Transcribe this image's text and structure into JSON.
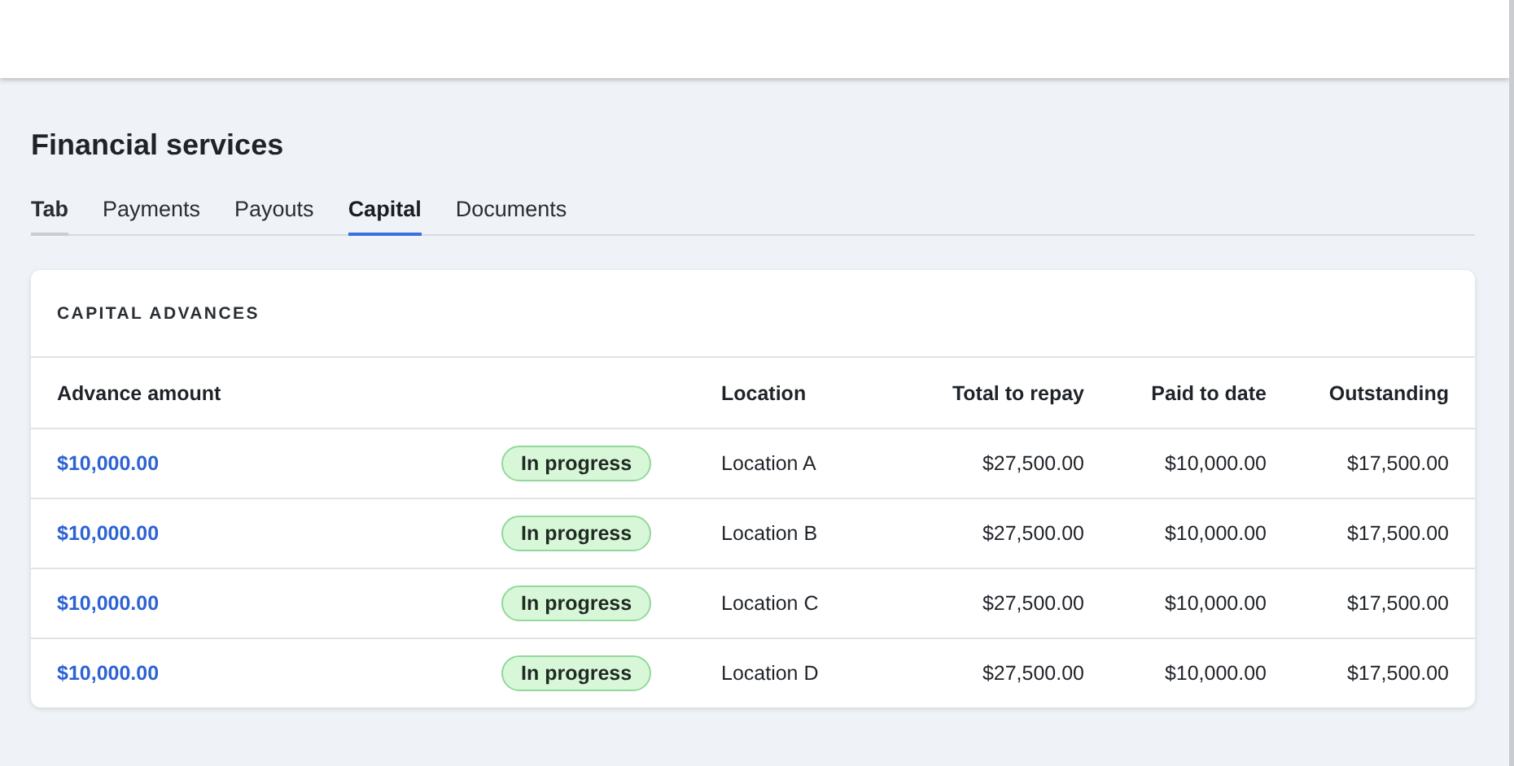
{
  "page": {
    "title": "Financial services"
  },
  "tabs": [
    {
      "label": "Tab",
      "selected": false,
      "hovered": true
    },
    {
      "label": "Payments",
      "selected": false,
      "hovered": false
    },
    {
      "label": "Payouts",
      "selected": false,
      "hovered": false
    },
    {
      "label": "Capital",
      "selected": true,
      "hovered": false
    },
    {
      "label": "Documents",
      "selected": false,
      "hovered": false
    }
  ],
  "card": {
    "title": "CAPITAL ADVANCES",
    "columns": [
      "Advance amount",
      "Location",
      "Total to repay",
      "Paid to date",
      "Outstanding"
    ],
    "rows": [
      {
        "amount": "$10,000.00",
        "status": {
          "label": "In progress",
          "kind": "success"
        },
        "location": "Location A",
        "total": "$27,500.00",
        "paid": "$10,000.00",
        "outstanding": "$17,500.00"
      },
      {
        "amount": "$10,000.00",
        "status": {
          "label": "In progress",
          "kind": "success"
        },
        "location": "Location B",
        "total": "$27,500.00",
        "paid": "$10,000.00",
        "outstanding": "$17,500.00"
      },
      {
        "amount": "$10,000.00",
        "status": {
          "label": "In progress",
          "kind": "success"
        },
        "location": "Location C",
        "total": "$27,500.00",
        "paid": "$10,000.00",
        "outstanding": "$17,500.00"
      },
      {
        "amount": "$10,000.00",
        "status": {
          "label": "In progress",
          "kind": "success"
        },
        "location": "Location D",
        "total": "$27,500.00",
        "paid": "$10,000.00",
        "outstanding": "$17,500.00"
      }
    ]
  }
}
